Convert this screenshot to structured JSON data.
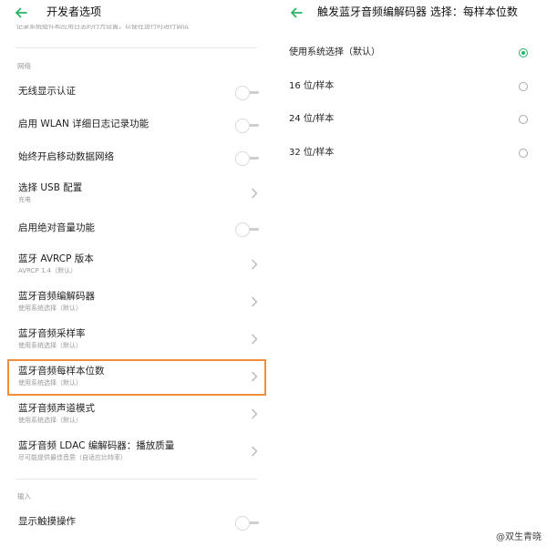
{
  "accent_color": "#2bb368",
  "highlight_color": "#f08e3c",
  "left": {
    "title": "开发者选项",
    "back_icon": "back-arrow-icon",
    "clipped_subtitle": "记录系统组件和应用日志的行为设置，以便在运行时进行调试",
    "sections": {
      "network": "网络",
      "input": "输入"
    },
    "rows": [
      {
        "title": "无线显示认证",
        "control": "toggle"
      },
      {
        "title": "启用 WLAN 详细日志记录功能",
        "control": "toggle"
      },
      {
        "title": "始终开启移动数据网络",
        "control": "toggle"
      },
      {
        "title": "选择 USB 配置",
        "subtitle": "充电",
        "control": "chevron"
      },
      {
        "title": "启用绝对音量功能",
        "control": "toggle"
      },
      {
        "title": "蓝牙 AVRCP 版本",
        "subtitle": "AVRCP 1.4（默认）",
        "control": "chevron"
      },
      {
        "title": "蓝牙音频编解码器",
        "subtitle": "使用系统选择（默认）",
        "control": "chevron"
      },
      {
        "title": "蓝牙音频采样率",
        "subtitle": "使用系统选择（默认）",
        "control": "chevron"
      },
      {
        "title": "蓝牙音频每样本位数",
        "subtitle": "使用系统选择（默认）",
        "control": "chevron",
        "highlighted": true
      },
      {
        "title": "蓝牙音频声道模式",
        "subtitle": "使用系统选择（默认）",
        "control": "chevron"
      },
      {
        "title": "蓝牙音频 LDAC 编解码器：播放质量",
        "subtitle": "尽可能提供最佳音质（自适应比特率）",
        "control": "chevron"
      },
      {
        "title": "显示触摸操作",
        "control": "toggle"
      }
    ]
  },
  "right": {
    "title": "触发蓝牙音频编解码器 选择：每样本位数",
    "back_icon": "back-arrow-icon",
    "options": [
      {
        "label": "使用系统选择（默认）",
        "selected": true
      },
      {
        "label": "16 位/样本",
        "selected": false
      },
      {
        "label": "24 位/样本",
        "selected": false
      },
      {
        "label": "32 位/样本",
        "selected": false
      }
    ]
  },
  "watermark": "@双生青晓"
}
